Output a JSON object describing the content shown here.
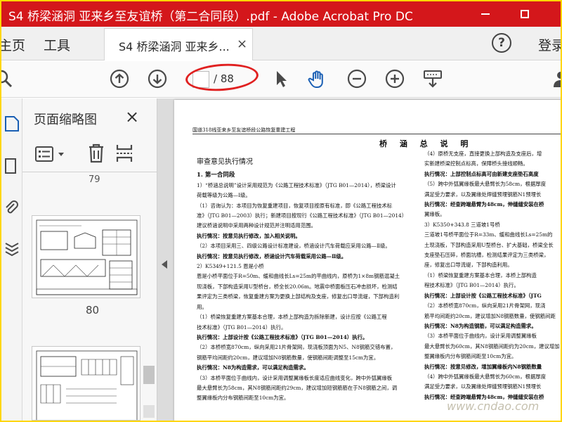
{
  "window": {
    "title": "S4 桥梁涵洞 亚来乡至友谊桥（第二合同段）.pdf - Adobe Acrobat Pro DC",
    "watermark": "www.cndao.com"
  },
  "nav": {
    "home": "主页",
    "tools": "工具",
    "signin": "登录"
  },
  "tab": {
    "label": "S4 桥梁涵洞 亚来乡...",
    "close": "×"
  },
  "toolbar": {
    "page_input": "",
    "page_total": "/ 88",
    "highlight_color": "#e02020"
  },
  "thumbnails": {
    "title": "页面缩略图",
    "close": "×",
    "pages": [
      "79",
      "80"
    ]
  },
  "document": {
    "header": "国道318线亚来乡至友谊桥段公路恢复重建工程",
    "title": "桥 涵 总 说 明",
    "left_col": [
      {
        "t": "审查意见执行情况",
        "c": "h1"
      },
      {
        "t": "1. 第一合同段",
        "c": "h2"
      },
      {
        "t": "1）“桥涵总说明”设计采用规范为《公路工程技术标准》（JTG B01—2014），桥梁设计",
        "c": ""
      },
      {
        "t": "荷载等级为公路—Ⅰ级。",
        "c": ""
      },
      {
        "t": "（1）咨询认为：本项目为恢复重建项目，恢复项目按原有标准，即《公路工程技术标",
        "c": ""
      },
      {
        "t": "准》（JTG B01—2003）执行；新建项目按现行《公路工程技术标准》（JTG B01—2014）执行，",
        "c": ""
      },
      {
        "t": "建议桥涵说明中采用两种设计规范并注明适用范围。",
        "c": ""
      },
      {
        "t": "执行情况：按意见执行修改，加入相关说明。",
        "c": "b"
      },
      {
        "t": "（2）本项目采用三、四级公路设计标准建设，桥涵设计汽车荷载应采用公路—Ⅱ级。",
        "c": ""
      },
      {
        "t": "执行情况：按意见执行修改，桥涵设计汽车荷载采用公路—Ⅱ级。",
        "c": "b"
      },
      {
        "t": "2）K5349+121.5 恩是小桥",
        "c": ""
      },
      {
        "t": "恩是小桥平面位于R=50m、缓和曲线长Ls=25m的平曲线内，原桥为1×8m钢筋混凝土",
        "c": ""
      },
      {
        "t": "现浇板，下部构造采用U型桥台，桥全长20.06m。地震中桥面板压石冲击损坏，检测结",
        "c": ""
      },
      {
        "t": "果评定为三类桥梁，恢复重建方案为更换上部结构及支座，修复出口导流堤，下部构造利",
        "c": ""
      },
      {
        "t": "用。",
        "c": ""
      },
      {
        "t": "（1）桥梁恢复重建方案基本合理，本桥上部构造为拆除新建，设计应按《公路工程",
        "c": ""
      },
      {
        "t": "技术标准》（JTG B01—2014）执行。",
        "c": ""
      },
      {
        "t": "执行情况：上部设计按《公路工程技术标准》（JTG B01—2014）执行。",
        "c": "b"
      },
      {
        "t": "（2）本桥桥宽870cm，纵向采用21片骨架网，现浇板顶面为N5、N8钢筋交错布置，",
        "c": ""
      },
      {
        "t": "钢筋平均间距约20cm，建议增加N8钢筋数量，使钢筋间距调整至15cm为宜。",
        "c": ""
      },
      {
        "t": "执行情况：N8为构造需求，可以满足构造需求。",
        "c": "b"
      },
      {
        "t": "（3）本桥平面位于曲线内，设计采用调整翼缘板长度适应曲线变化，跨中外弧翼缘板",
        "c": ""
      },
      {
        "t": "最大悬臂长为58cm，其N8钢筋间距约29cm，建议增加短钢筋筋在于N8钢筋之间，调",
        "c": ""
      },
      {
        "t": "整翼缘板内分布钢筋间距至10cm为宜。",
        "c": ""
      }
    ],
    "right_col": [
      {
        "t": "（4）原桥无支座，直接更换上部构造及支座后，增",
        "c": ""
      },
      {
        "t": "实新建桥梁控制点标高，保障桥头接线顺畅。",
        "c": ""
      },
      {
        "t": "执行情况：上部控制点标高可由新建支座垫石高度",
        "c": "b"
      },
      {
        "t": "（5）跨中外弧翼缘板最大悬臂长为58cm，根据厚度",
        "c": ""
      },
      {
        "t": "满足受力要求，以及翼缘处焊缝预埋钢筋N1预埋长",
        "c": ""
      },
      {
        "t": "执行情况：经查跨端悬臂为48cm，伸缝缝安装在桥",
        "c": "b"
      },
      {
        "t": "翼缘板。",
        "c": ""
      },
      {
        "t": "3）K5350+343.8 三道坡1号桥",
        "c": ""
      },
      {
        "t": "三道坡1号桥平面位于R=33m、缓和曲线长Ls=25m的",
        "c": ""
      },
      {
        "t": "土现浇板，下部构造采用U型桥台、扩大基础，桥梁全长",
        "c": ""
      },
      {
        "t": "支座垫石压碎，桥面坑槽，检测结果评定为三类桥梁，",
        "c": ""
      },
      {
        "t": "座，修复出口导流堤，下部构造利用。",
        "c": ""
      },
      {
        "t": "（1）桥梁恢复重建方案基本合理，本桥上部构造",
        "c": ""
      },
      {
        "t": "程技术标准》（JTG B01—2014）执行。",
        "c": ""
      },
      {
        "t": "执行情况：上部设计按《公路工程技术标准》（JTG",
        "c": "b"
      },
      {
        "t": "（2）本桥桥宽870cm，纵向采用21片骨架网，现浇",
        "c": ""
      },
      {
        "t": "筋平均间距约20cm，建议增加N8钢筋数量，使钢筋间距",
        "c": ""
      },
      {
        "t": "执行情况：N8为构造钢筋，可以满足构造需求。",
        "c": "b"
      },
      {
        "t": "（3）本桥平面位于曲线内，设计采用调整翼缘板",
        "c": ""
      },
      {
        "t": "最大悬臂长为60cm，其N8钢筋间距约为20cm，建议增加",
        "c": ""
      },
      {
        "t": "整翼缘板内分布钢筋间距至10cm为宜。",
        "c": ""
      },
      {
        "t": "执行情况：按意见修改，增加翼缘板内N8钢筋数量",
        "c": "b"
      },
      {
        "t": "（4）跨中外弧翼缘板最大悬臂长为60cm，根据厚度",
        "c": ""
      },
      {
        "t": "满足受力要求，以及翼缘处焊缝预埋钢筋N1预埋长",
        "c": ""
      },
      {
        "t": "执行情况：经查跨端悬臂为48cm，伸缝缝安装在桥",
        "c": "b"
      }
    ]
  }
}
